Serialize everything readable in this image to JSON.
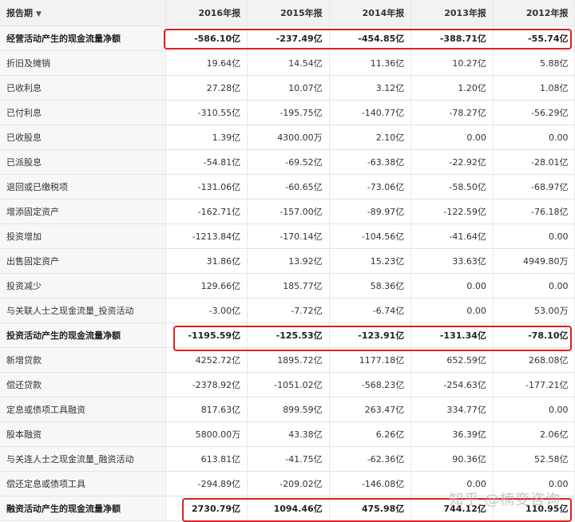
{
  "header": {
    "period_label": "报告期",
    "years": [
      "2016年报",
      "2015年报",
      "2014年报",
      "2013年报",
      "2012年报"
    ]
  },
  "rows": [
    {
      "label": "经营活动产生的现金流量净额",
      "bold": true,
      "highlight": true,
      "values": [
        "-586.10亿",
        "-237.49亿",
        "-454.85亿",
        "-388.71亿",
        "-55.74亿"
      ]
    },
    {
      "label": "折旧及摊销",
      "values": [
        "19.64亿",
        "14.54亿",
        "11.36亿",
        "10.27亿",
        "5.88亿"
      ]
    },
    {
      "label": "已收利息",
      "values": [
        "27.28亿",
        "10.07亿",
        "3.12亿",
        "1.20亿",
        "1.08亿"
      ]
    },
    {
      "label": "已付利息",
      "values": [
        "-310.55亿",
        "-195.75亿",
        "-140.77亿",
        "-78.27亿",
        "-56.29亿"
      ]
    },
    {
      "label": "已收股息",
      "values": [
        "1.39亿",
        "4300.00万",
        "2.10亿",
        "0.00",
        "0.00"
      ]
    },
    {
      "label": "已派股息",
      "values": [
        "-54.81亿",
        "-69.52亿",
        "-63.38亿",
        "-22.92亿",
        "-28.01亿"
      ]
    },
    {
      "label": "退回或已缴税项",
      "values": [
        "-131.06亿",
        "-60.65亿",
        "-73.06亿",
        "-58.50亿",
        "-68.97亿"
      ]
    },
    {
      "label": "增添固定资产",
      "values": [
        "-162.71亿",
        "-157.00亿",
        "-89.97亿",
        "-122.59亿",
        "-76.18亿"
      ]
    },
    {
      "label": "投资增加",
      "values": [
        "-1213.84亿",
        "-170.14亿",
        "-104.56亿",
        "-41.64亿",
        "0.00"
      ]
    },
    {
      "label": "出售固定资产",
      "values": [
        "31.86亿",
        "13.92亿",
        "15.23亿",
        "33.63亿",
        "4949.80万"
      ]
    },
    {
      "label": "投资减少",
      "values": [
        "129.66亿",
        "185.77亿",
        "58.36亿",
        "0.00",
        "0.00"
      ]
    },
    {
      "label": "与关联人士之现金流量_投资活动",
      "values": [
        "-3.00亿",
        "-7.72亿",
        "-6.74亿",
        "0.00",
        "53.00万"
      ]
    },
    {
      "label": "投资活动产生的现金流量净额",
      "bold": true,
      "highlight": true,
      "values": [
        "-1195.59亿",
        "-125.53亿",
        "-123.91亿",
        "-131.34亿",
        "-78.10亿"
      ]
    },
    {
      "label": "新增贷款",
      "values": [
        "4252.72亿",
        "1895.72亿",
        "1177.18亿",
        "652.59亿",
        "268.08亿"
      ]
    },
    {
      "label": "偿还贷款",
      "values": [
        "-2378.92亿",
        "-1051.02亿",
        "-568.23亿",
        "-254.63亿",
        "-177.21亿"
      ]
    },
    {
      "label": "定息或债项工具融资",
      "values": [
        "817.63亿",
        "899.59亿",
        "263.47亿",
        "334.77亿",
        "0.00"
      ]
    },
    {
      "label": "股本融资",
      "values": [
        "5800.00万",
        "43.38亿",
        "6.26亿",
        "36.39亿",
        "2.06亿"
      ]
    },
    {
      "label": "与关连人士之现金流量_融资活动",
      "values": [
        "613.81亿",
        "-41.75亿",
        "-62.36亿",
        "90.36亿",
        "52.58亿"
      ]
    },
    {
      "label": "偿还定息或债项工具",
      "values": [
        "-294.89亿",
        "-209.02亿",
        "-146.08亿",
        "0.00",
        "0.00"
      ]
    },
    {
      "label": "融资活动产生的现金流量净额",
      "bold": true,
      "highlight": true,
      "values": [
        "2730.79亿",
        "1094.46亿",
        "475.98亿",
        "744.12亿",
        "110.95亿"
      ]
    }
  ],
  "watermark": "知乎 @楠变咨询",
  "colors": {
    "highlight_box": "#e0201f",
    "header_bg": "#f2f2f2",
    "label_bg": "#f7f7f7"
  }
}
